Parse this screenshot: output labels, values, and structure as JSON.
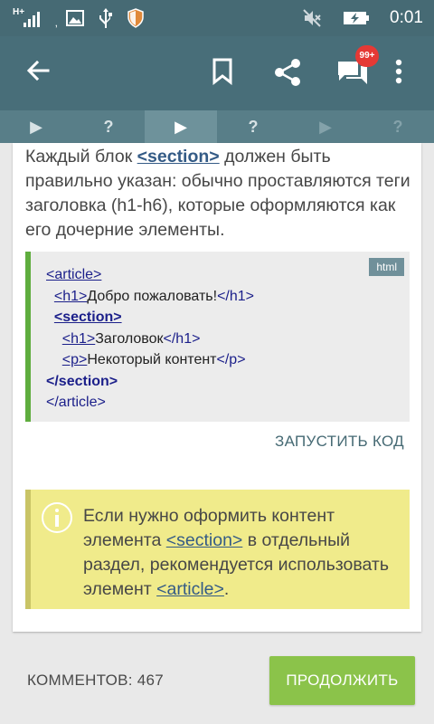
{
  "status_bar": {
    "network": "H+",
    "time": "0:01",
    "icons": [
      "signal-icon",
      "image-notification-icon",
      "usb-icon",
      "shield-icon",
      "mute-icon",
      "battery-charging-icon"
    ]
  },
  "app_bar": {
    "icons": [
      "back-arrow-icon",
      "bookmark-icon",
      "share-icon",
      "comments-icon",
      "more-vert-icon"
    ],
    "comments_badge": "99+"
  },
  "steps": [
    {
      "label": "▶",
      "state": "done"
    },
    {
      "label": "?",
      "state": "done"
    },
    {
      "label": "▶",
      "state": "active"
    },
    {
      "label": "?",
      "state": "pending"
    },
    {
      "label": "▶",
      "state": "locked"
    },
    {
      "label": "?",
      "state": "locked"
    }
  ],
  "content": {
    "paragraph": {
      "before": "Каждый блок ",
      "link": "<section>",
      "after": " должен быть правильно указан: обычно проставляются теги заголовка (h1-h6), которые оформляются как его дочерние элементы."
    },
    "code": {
      "language": "html",
      "lines": [
        {
          "indent": "",
          "open": "<article>",
          "text": "",
          "close": ""
        },
        {
          "indent": "  ",
          "open": "<h1>",
          "text": "Добро пожаловать!",
          "close": "</h1>"
        },
        {
          "indent": "  ",
          "open": "<section>",
          "text": "",
          "close": ""
        },
        {
          "indent": "    ",
          "open": "<h1>",
          "text": "Заголовок",
          "close": "</h1>"
        },
        {
          "indent": "    ",
          "open": "<p>",
          "text": "Некоторый контент",
          "close": "</p>"
        },
        {
          "indent": "",
          "open": "</section>",
          "text": "",
          "close": ""
        },
        {
          "indent": "",
          "open": "</article>",
          "text": "",
          "close": ""
        }
      ]
    },
    "run_button": "ЗАПУСТИТЬ КОД",
    "tip": {
      "part1": "Если нужно оформить контент элемента ",
      "link1": "<section>",
      "part2": " в отдельный раздел, рекомендуется использовать элемент ",
      "link2": "<article>",
      "part3": "."
    }
  },
  "footer": {
    "comments_label": "КОММЕНТОВ: 467",
    "continue_button": "ПРОДОЛЖИТЬ"
  },
  "colors": {
    "status_bar": "#466a74",
    "app_bar": "#486e79",
    "steps_bar": "#587e88",
    "accent_green": "#8bc34a",
    "code_border": "#5fad3e",
    "tip_bg": "#f0eb8b",
    "badge": "#e53935"
  }
}
